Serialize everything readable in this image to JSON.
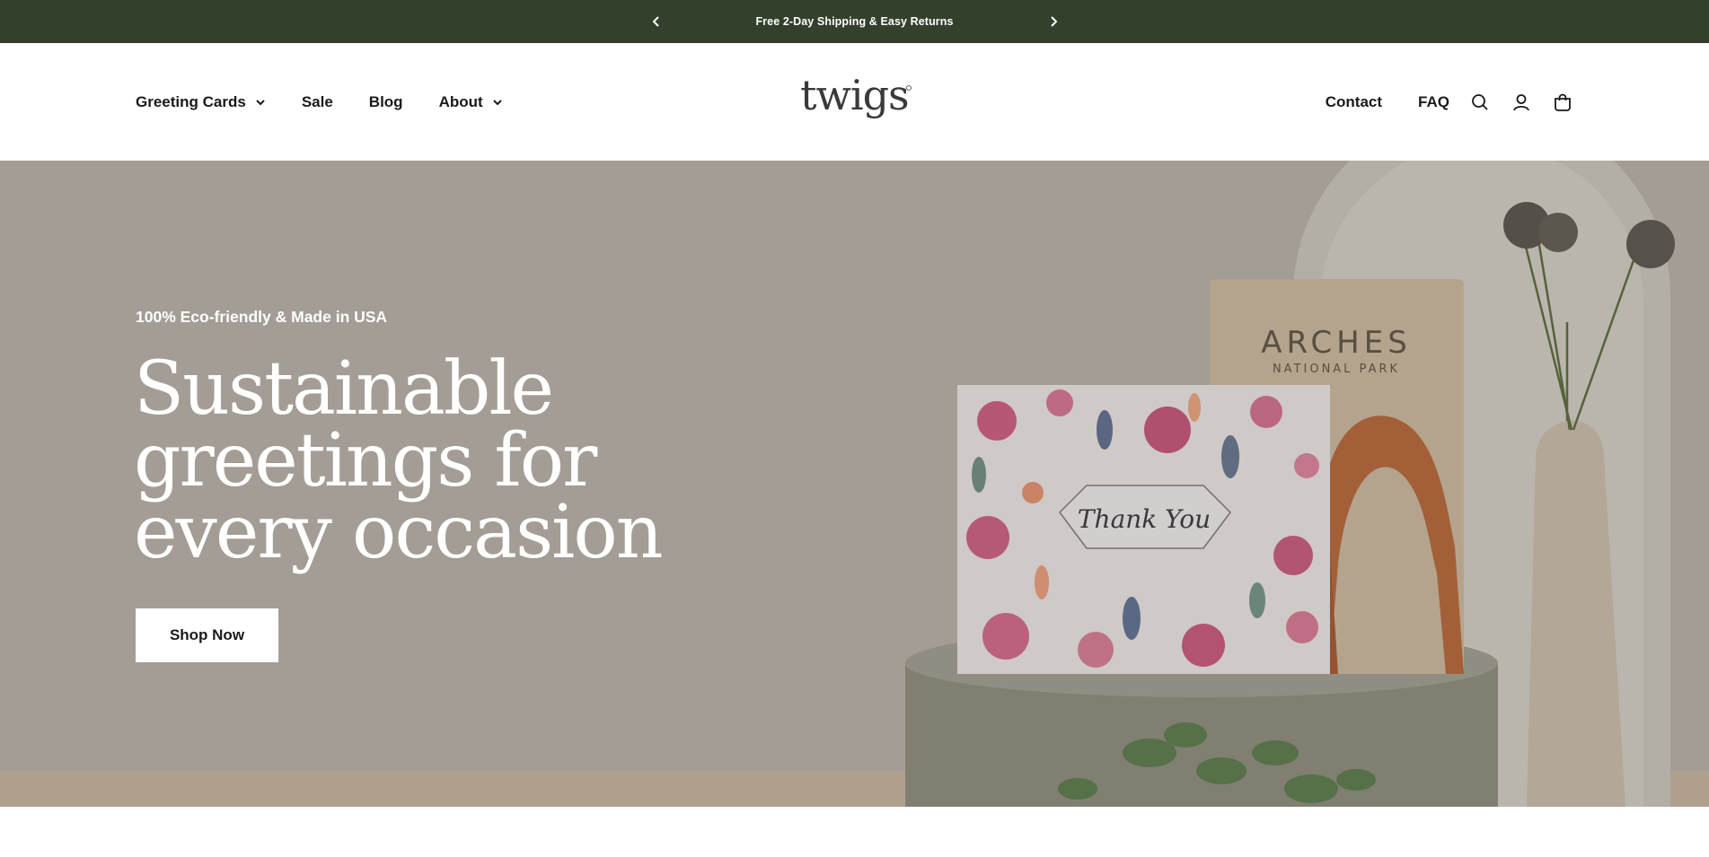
{
  "announcement": {
    "text": "Free 2-Day Shipping & Easy Returns",
    "prev_icon": "chevron-left-icon",
    "next_icon": "chevron-right-icon"
  },
  "header": {
    "logo_text": "twigs",
    "nav_left": [
      {
        "label": "Greeting Cards",
        "has_dropdown": true
      },
      {
        "label": "Sale",
        "has_dropdown": false
      },
      {
        "label": "Blog",
        "has_dropdown": false
      },
      {
        "label": "About",
        "has_dropdown": true
      }
    ],
    "nav_right": [
      {
        "label": "Contact"
      },
      {
        "label": "FAQ"
      }
    ],
    "icons": [
      "search-icon",
      "account-icon",
      "cart-icon"
    ]
  },
  "hero": {
    "eyebrow": "100% Eco-friendly & Made in USA",
    "headline": "Sustainable greetings for every occasion",
    "cta_label": "Shop Now",
    "card_front_text": "Thank You",
    "card_back_title": "ARCHES",
    "card_back_subtitle": "NATIONAL PARK"
  },
  "colors": {
    "announcement_bg": "#33402c",
    "hero_bg": "#b3ada4",
    "text_dark": "#1a1a1a"
  }
}
